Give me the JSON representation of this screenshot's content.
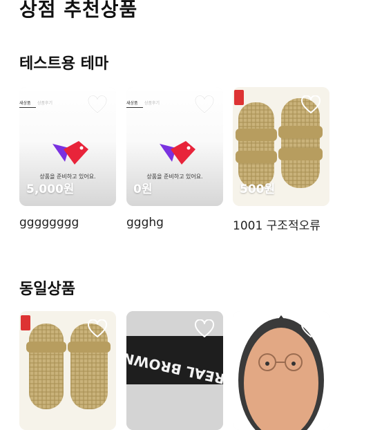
{
  "page": {
    "title": "상점 추천상품"
  },
  "sections": [
    {
      "title": "테스트용 테마",
      "items": [
        {
          "name": "gggggggg",
          "price": "5,000원",
          "placeholder_tab1": "새상품",
          "placeholder_tab2": "상품후기",
          "placeholder_msg": "상품을 준비하고 있어요."
        },
        {
          "name": "ggghg",
          "price": "0원",
          "placeholder_tab1": "새상품",
          "placeholder_tab2": "상품후기",
          "placeholder_msg": "상품을 준비하고 있어요."
        },
        {
          "name": "1001 구조적오류",
          "price": "500원"
        }
      ]
    },
    {
      "title": "동일상품",
      "items": [
        {
          "image_alt": "sandals"
        },
        {
          "image_alt": "real-brown",
          "image_text": "REAL BROWN"
        },
        {
          "image_alt": "pouch"
        }
      ]
    }
  ],
  "colors": {
    "brand_red": "#e8243a",
    "brand_purple": "#7a32e0",
    "text": "#111111"
  }
}
